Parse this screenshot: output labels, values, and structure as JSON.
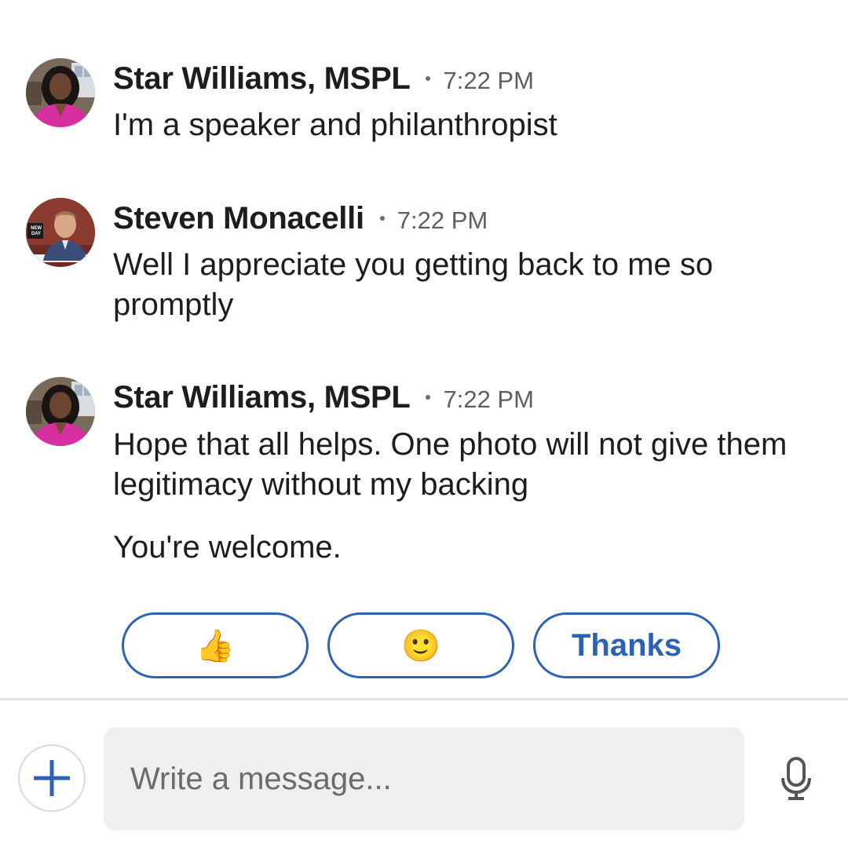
{
  "messages": [
    {
      "sender": "Star Williams, MSPL",
      "time": "7:22 PM",
      "avatar_icon": "star-williams-avatar",
      "lines": [
        "I'm a speaker and philanthropist"
      ]
    },
    {
      "sender": "Steven Monacelli",
      "time": "7:22 PM",
      "avatar_icon": "steven-monacelli-avatar",
      "avatar_badge": "NEW DAY",
      "lines": [
        "Well I appreciate you getting back to me so promptly"
      ]
    },
    {
      "sender": "Star Williams, MSPL",
      "time": "7:22 PM",
      "avatar_icon": "star-williams-avatar",
      "lines": [
        "Hope that all helps. One photo will not give them legitimacy without my backing",
        "You're welcome."
      ]
    }
  ],
  "quick_replies": [
    {
      "label": "👍",
      "icon": "thumbs-up-emoji"
    },
    {
      "label": "🙂",
      "icon": "smiley-emoji"
    },
    {
      "label": "Thanks"
    }
  ],
  "composer": {
    "placeholder": "Write a message...",
    "add_icon": "plus-icon",
    "mic_icon": "microphone-icon"
  },
  "colors": {
    "accent": "#2e63b3",
    "input_bg": "#eef0ed",
    "text": "#1d1d1d",
    "muted": "#5e5e5e"
  }
}
